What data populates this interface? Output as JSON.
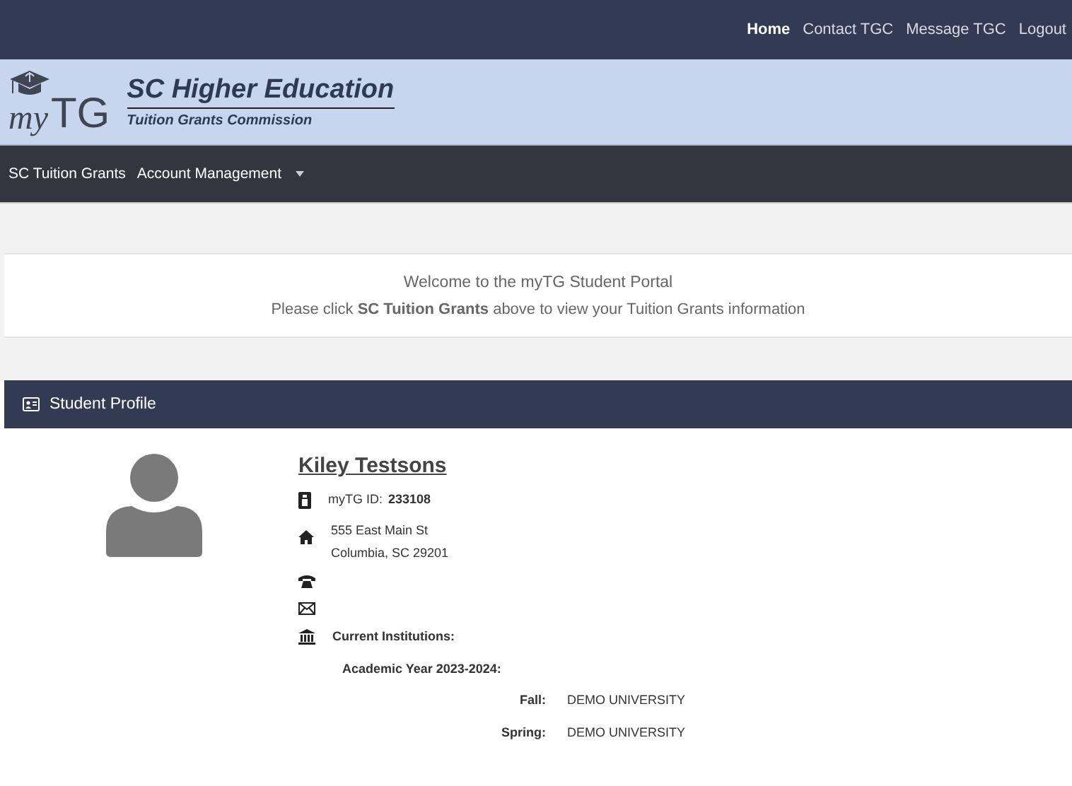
{
  "top_links": [
    {
      "label": "Home",
      "selected": true
    },
    {
      "label": "Contact TGC",
      "selected": false
    },
    {
      "label": "Message TGC",
      "selected": false
    },
    {
      "label": "Logout",
      "selected": false
    }
  ],
  "brand": {
    "logo_small": "my",
    "logo_big": "TG",
    "title": "SC Higher Education",
    "subtitle": "Tuition Grants Commission"
  },
  "nav": [
    {
      "label": "SC Tuition Grants",
      "kind": "link"
    },
    {
      "label": "Account Management",
      "kind": "dropdown"
    }
  ],
  "welcome": {
    "heading": "Welcome to the myTG Student Portal",
    "message": "Please click **SC Tuition Grants** above to view your Tuition Grants information"
  },
  "profile": {
    "title": "Student Profile",
    "name": "Kiley Testsons",
    "id_label": "myTG ID:",
    "id_value": "233108",
    "address": [
      "555 East Main St",
      "Columbia, SC 29201"
    ],
    "institutions_label": "Current Institutions:",
    "academic_year": "Academic Year 2023-2024:",
    "terms": [
      {
        "term": "Fall:",
        "institution": "DEMO UNIVERSITY"
      },
      {
        "term": "Spring:",
        "institution": "DEMO UNIVERSITY"
      }
    ]
  }
}
